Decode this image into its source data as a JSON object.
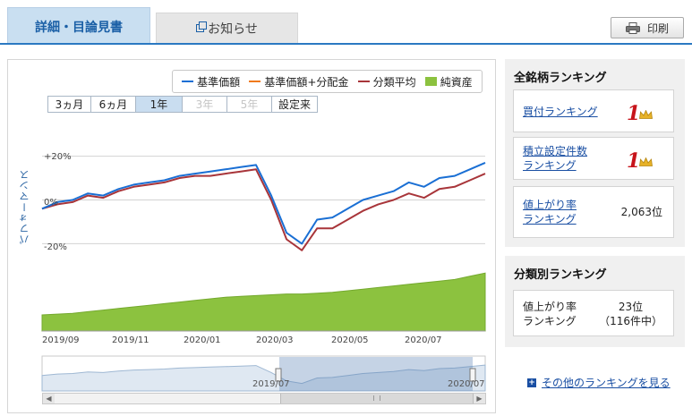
{
  "tabs": {
    "detail": "詳細・目論見書",
    "news": "お知らせ",
    "print": "印刷"
  },
  "legend": [
    {
      "label": "基準価額",
      "color": "#1a6fd4",
      "kind": "line"
    },
    {
      "label": "基準価額+分配金",
      "color": "#f07a1a",
      "kind": "line"
    },
    {
      "label": "分類平均",
      "color": "#a8353a",
      "kind": "line"
    },
    {
      "label": "純資産",
      "color": "#8cc23f",
      "kind": "box"
    }
  ],
  "periods": [
    {
      "label": "3ヵ月",
      "state": "normal"
    },
    {
      "label": "6ヵ月",
      "state": "normal"
    },
    {
      "label": "1年",
      "state": "active"
    },
    {
      "label": "3年",
      "state": "disabled"
    },
    {
      "label": "5年",
      "state": "disabled"
    },
    {
      "label": "設定来",
      "state": "normal"
    }
  ],
  "chart": {
    "ylabel": "パフォーマンス",
    "yticks": [
      "+20%",
      "0%",
      "-20%"
    ],
    "xticks": [
      "2019/09",
      "2019/11",
      "2020/01",
      "2020/03",
      "2020/05",
      "2020/07"
    ],
    "navigator_labels": [
      "2019/07",
      "2020/07"
    ],
    "scroll_grip": "III"
  },
  "chart_data": {
    "type": "line",
    "x": [
      "2019/08/13",
      "2019/08/27",
      "2019/09/10",
      "2019/09/24",
      "2019/10/08",
      "2019/10/22",
      "2019/11/05",
      "2019/11/19",
      "2019/12/03",
      "2019/12/17",
      "2019/12/31",
      "2020/01/14",
      "2020/01/28",
      "2020/02/11",
      "2020/02/20",
      "2020/03/01",
      "2020/03/09",
      "2020/03/16",
      "2020/03/23",
      "2020/04/01",
      "2020/04/14",
      "2020/04/28",
      "2020/05/12",
      "2020/05/26",
      "2020/06/09",
      "2020/06/23",
      "2020/07/07",
      "2020/07/21",
      "2020/08/04",
      "2020/08/14"
    ],
    "ylim": [
      -28,
      28
    ],
    "series": [
      {
        "name": "基準価額",
        "color": "#1a6fd4",
        "values": [
          -4,
          -1,
          0,
          3,
          2,
          5,
          7,
          8,
          9,
          11,
          12,
          13,
          14,
          15,
          16,
          2,
          -15,
          -20,
          -9,
          -8,
          -4,
          0,
          2,
          4,
          8,
          6,
          10,
          11,
          14,
          17
        ]
      },
      {
        "name": "分類平均",
        "color": "#a8353a",
        "values": [
          -4,
          -2,
          -1,
          2,
          1,
          4,
          6,
          7,
          8,
          10,
          11,
          11,
          12,
          13,
          14,
          0,
          -18,
          -23,
          -13,
          -13,
          -9,
          -5,
          -2,
          0,
          3,
          1,
          5,
          6,
          9,
          12
        ]
      },
      {
        "name": "純資産",
        "color": "#8cc23f",
        "values": [
          10,
          10.5,
          11,
          12,
          13,
          14,
          15,
          16,
          17,
          18,
          19,
          20,
          21,
          21.5,
          22,
          22.5,
          23,
          23,
          23.5,
          24,
          25,
          26,
          27,
          28,
          29,
          30,
          31,
          32,
          34,
          36
        ]
      }
    ]
  },
  "ranking_all": {
    "title": "全銘柄ランキング",
    "items": [
      {
        "label_lines": [
          "買付ランキング"
        ],
        "rank": "1"
      },
      {
        "label_lines": [
          "積立設定件数",
          "ランキング"
        ],
        "rank": "1"
      },
      {
        "label_lines": [
          "値上がり率",
          "ランキング"
        ],
        "value": "2,063位"
      }
    ]
  },
  "ranking_category": {
    "title": "分類別ランキング",
    "item": {
      "label_lines": [
        "値上がり率",
        "ランキング"
      ],
      "value_lines": [
        "23位",
        "（116件中）"
      ]
    }
  },
  "more_link": "その他のランキングを見る"
}
